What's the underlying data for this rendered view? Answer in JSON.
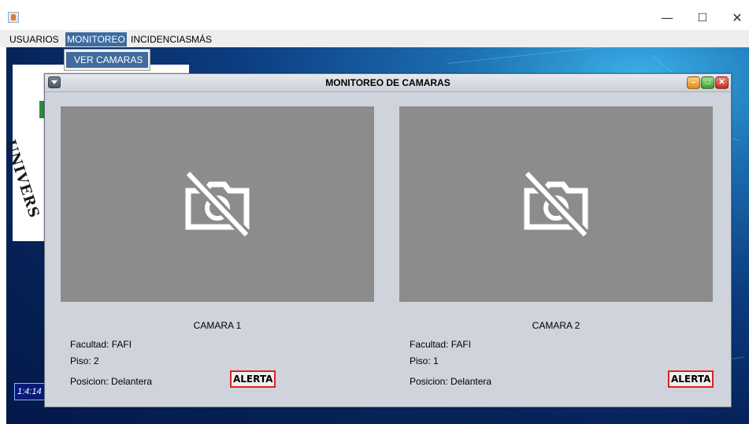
{
  "window": {
    "title": "",
    "minimize_glyph": "—",
    "maximize_glyph": "☐",
    "close_glyph": "✕"
  },
  "menubar": {
    "items": [
      {
        "label": "USUARIOS"
      },
      {
        "label": "MONITOREO"
      },
      {
        "label": "INCIDENCIAS"
      },
      {
        "label": "MÁS"
      }
    ],
    "active": "MONITOREO"
  },
  "dropdown": {
    "items": [
      {
        "label": "VER CAMARAS"
      }
    ]
  },
  "desktop": {
    "logo_text": "UNIVERS",
    "clock": "1:4:14"
  },
  "frame": {
    "title": "MONITOREO DE CAMARAS",
    "min_glyph": "–",
    "max_glyph": "□",
    "close_glyph": "✕"
  },
  "cameras": [
    {
      "name": "CAMARA 1",
      "facultad": "Facultad: FAFI",
      "piso": "Piso: 2",
      "posicion": "Posicion: Delantera",
      "alert_label": "ALERTA",
      "icon": "camera-off-icon"
    },
    {
      "name": "CAMARA 2",
      "facultad": "Facultad: FAFI",
      "piso": "Piso: 1",
      "posicion": "Posicion: Delantera",
      "alert_label": "ALERTA",
      "icon": "camera-off-icon"
    }
  ],
  "colors": {
    "menu_active": "#3b6ca3",
    "camera_bg": "#8c8c8c",
    "alert_border": "#e02020",
    "frame_bg": "#cfd4dc"
  }
}
